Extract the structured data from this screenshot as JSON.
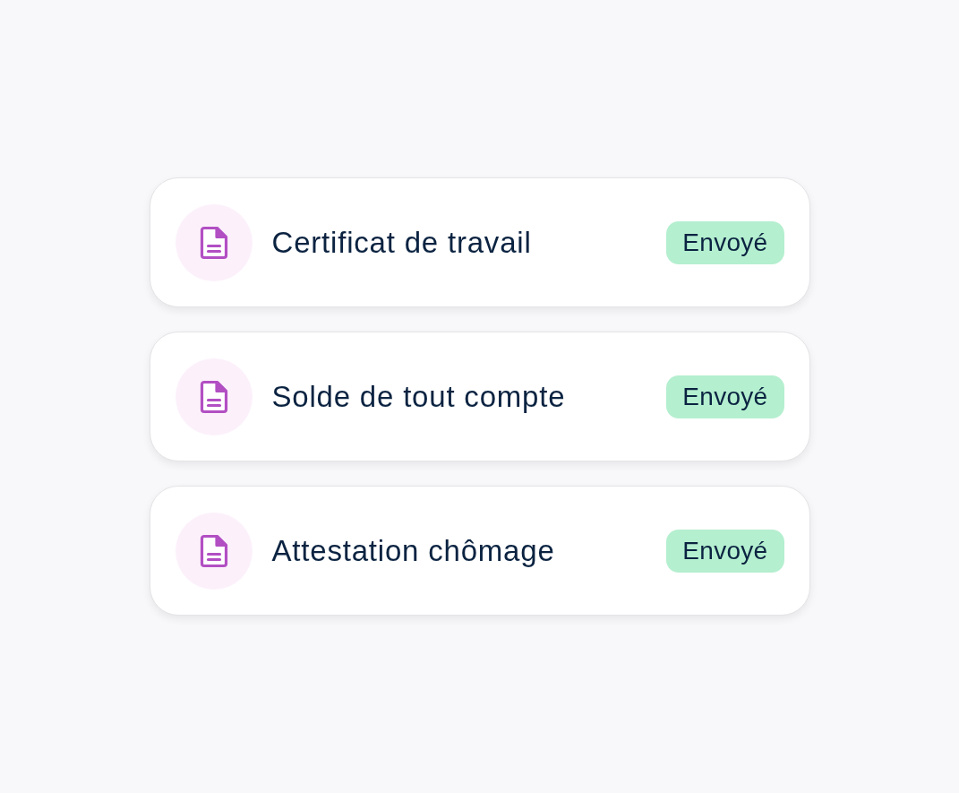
{
  "documents": [
    {
      "title": "Certificat de travail",
      "status": "Envoyé"
    },
    {
      "title": "Solde de tout compte",
      "status": "Envoyé"
    },
    {
      "title": "Attestation chômage",
      "status": "Envoyé"
    }
  ]
}
